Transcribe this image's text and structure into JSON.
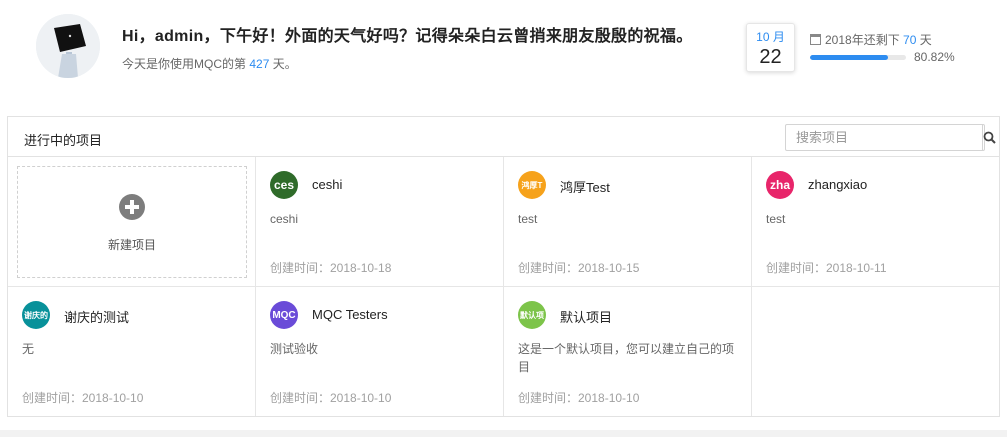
{
  "header": {
    "greeting": "Hi，admin，下午好！外面的天气好吗？记得朵朵白云曾捎来朋友殷殷的祝福。",
    "days_prefix": "今天是你使用MQC的第",
    "days_used": "427",
    "days_suffix": "天。",
    "date_month": "10 月",
    "date_day": "22",
    "remain_prefix": "2018年还剩下",
    "remain_days": "70",
    "remain_suffix": "天",
    "year_progress": 0.8082,
    "year_progress_label": "80.82%"
  },
  "panel": {
    "title": "进行中的项目",
    "search_placeholder": "搜索项目",
    "new_project_label": "新建项目"
  },
  "projects": [
    {
      "icon_text": "ces",
      "icon_color": "#2f6b2a",
      "name": "ceshi",
      "desc": "ceshi",
      "created": "创建时间：2018-10-18"
    },
    {
      "icon_text": "鸿厚T",
      "icon_color": "#f6a21b",
      "name": "鸿厚Test",
      "desc": "test",
      "created": "创建时间：2018-10-15"
    },
    {
      "icon_text": "zha",
      "icon_color": "#e8256a",
      "name": "zhangxiao",
      "desc": "test",
      "created": "创建时间：2018-10-11"
    },
    {
      "icon_text": "谢庆的",
      "icon_color": "#08919a",
      "name": "谢庆的测试",
      "desc": "无",
      "created": "创建时间：2018-10-10"
    },
    {
      "icon_text": "MQC",
      "icon_color": "#6a4bd8",
      "name": "MQC Testers",
      "desc": "测试验收",
      "created": "创建时间：2018-10-10"
    },
    {
      "icon_text": "默认项",
      "icon_color": "#7dc44a",
      "name": "默认项目",
      "desc": "这是一个默认项目，您可以建立自己的项目",
      "created": "创建时间：2018-10-10"
    }
  ]
}
